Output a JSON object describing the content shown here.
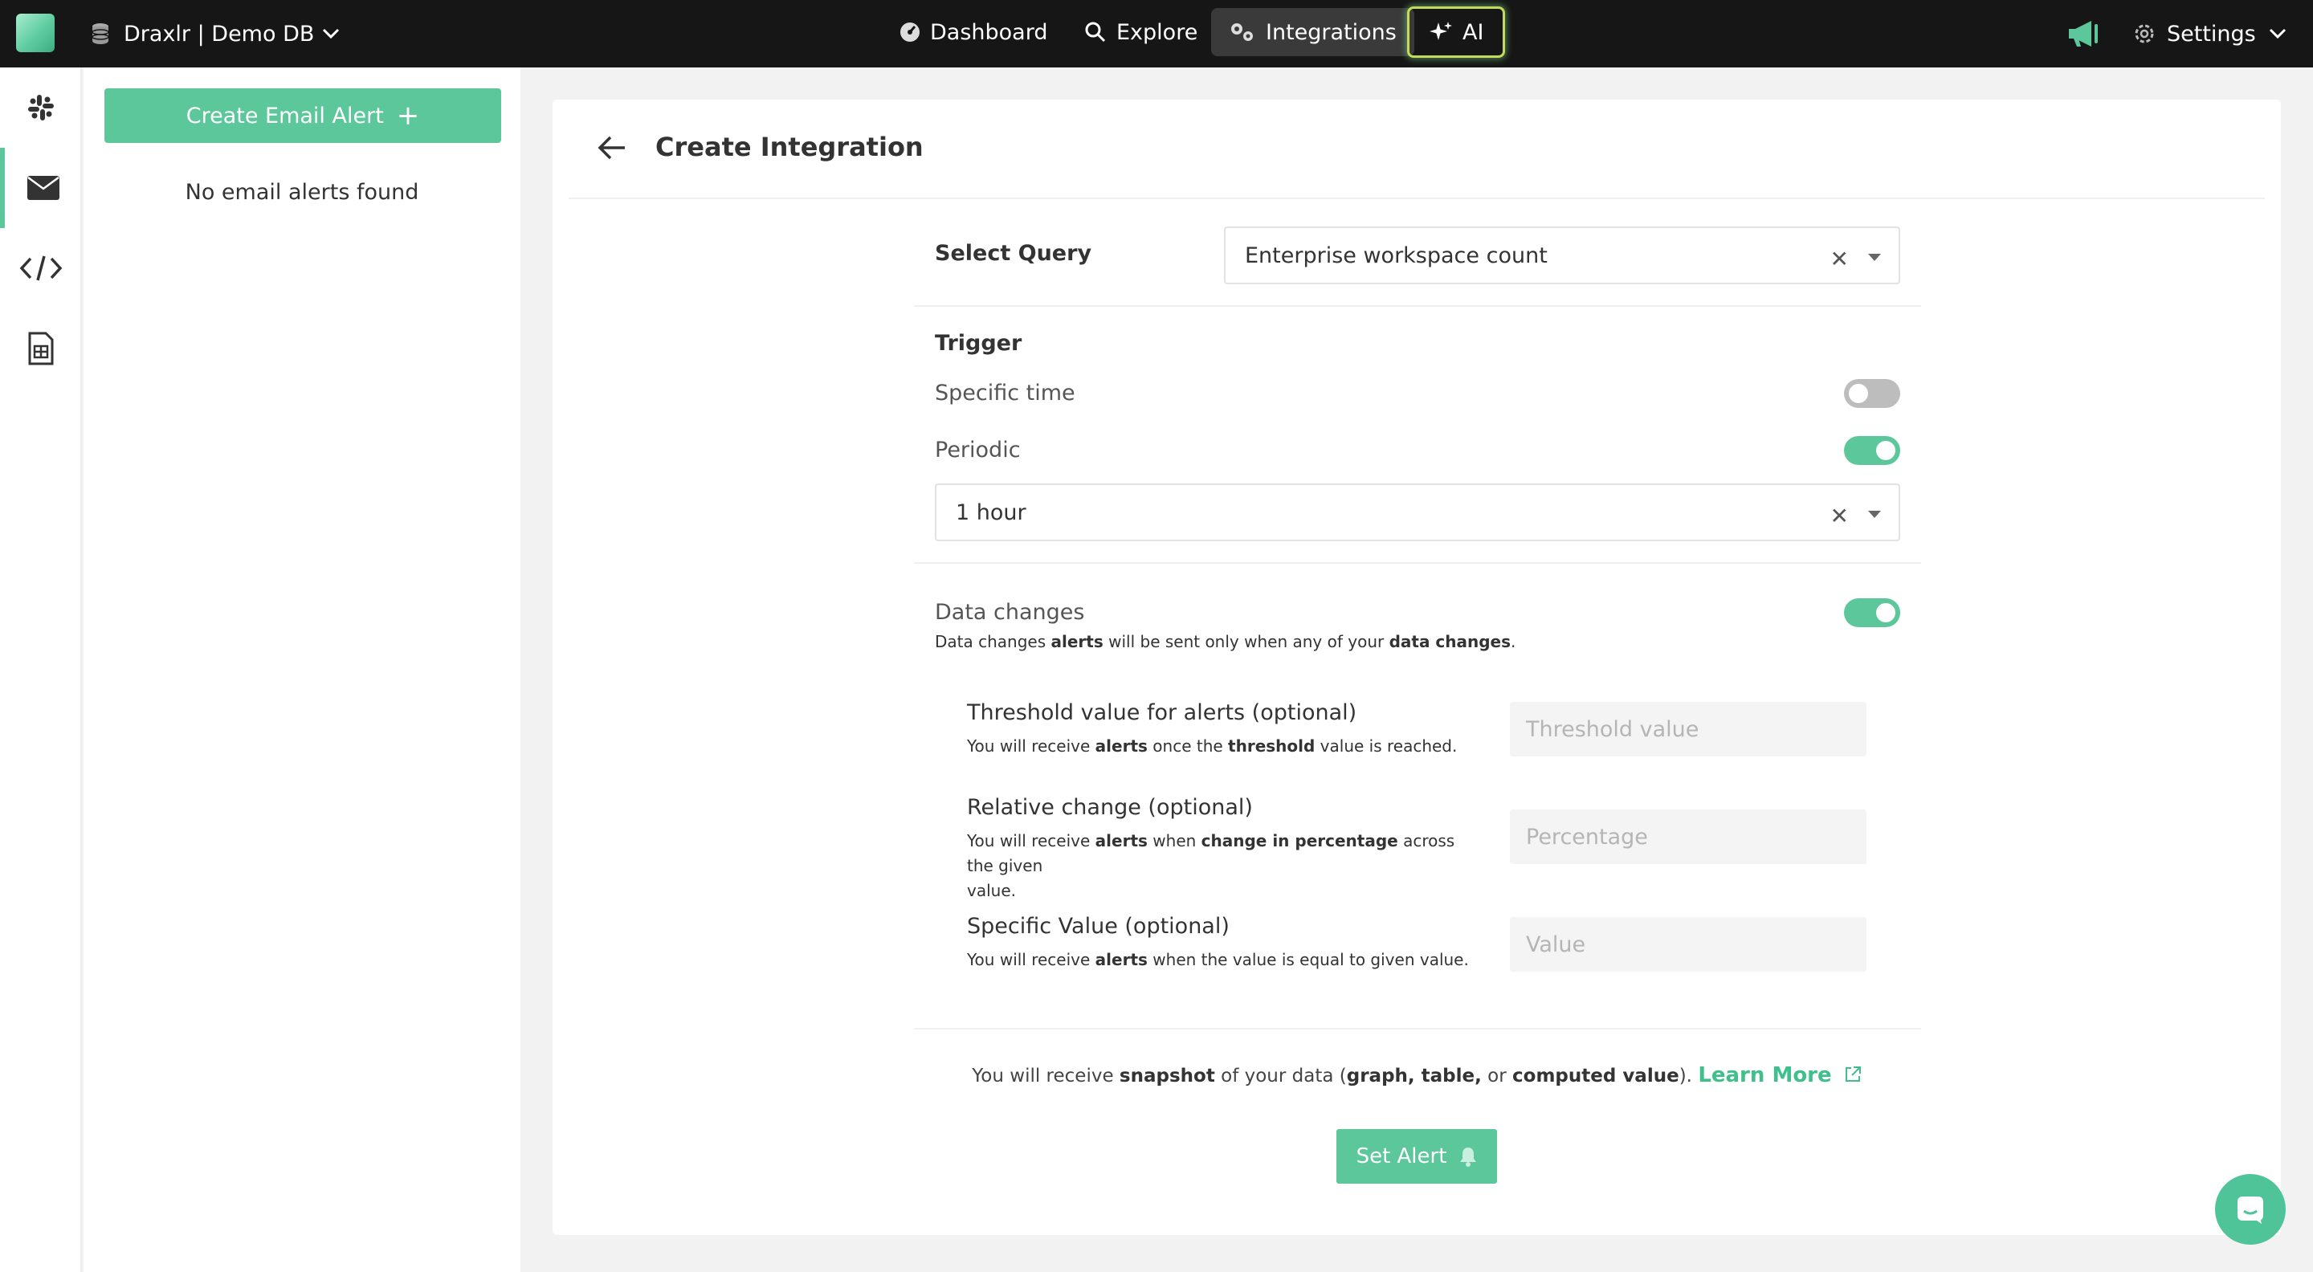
{
  "topbar": {
    "db_label": "Draxlr | Demo DB",
    "nav": {
      "dashboard": "Dashboard",
      "explore": "Explore",
      "integrations": "Integrations",
      "ai": "AI"
    },
    "settings": "Settings"
  },
  "sidebar": {
    "items": [
      "slack-icon",
      "email-icon",
      "code-icon",
      "sheet-icon"
    ],
    "active": "email-icon"
  },
  "alerts_panel": {
    "create_button": "Create Email Alert",
    "create_plus": "+",
    "empty_text": "No email alerts found"
  },
  "page": {
    "title": "Create Integration"
  },
  "form": {
    "select_query_label": "Select Query",
    "select_query_value": "Enterprise workspace count",
    "trigger_label": "Trigger",
    "specific_time_label": "Specific time",
    "specific_time_on": false,
    "periodic_label": "Periodic",
    "periodic_on": true,
    "periodic_value": "1 hour",
    "data_changes_label": "Data changes",
    "data_changes_on": true,
    "data_changes_help": {
      "t1": "Data changes ",
      "b1": "alerts",
      "t2": " will be sent only when any of your ",
      "b2": "data changes",
      "t3": "."
    },
    "threshold": {
      "label": "Threshold value for alerts (optional)",
      "help_t1": "You will receive ",
      "help_b1": "alerts",
      "help_t2": " once the ",
      "help_b2": "threshold",
      "help_t3": " value is reached.",
      "placeholder": "Threshold value"
    },
    "relative": {
      "label": "Relative change (optional)",
      "help_t1": "You will receive ",
      "help_b1": "alerts",
      "help_t2": " when ",
      "help_b2": "change in percentage",
      "help_t3": " across the given",
      "help_t4": "value.",
      "placeholder": "Percentage"
    },
    "specific_value": {
      "label": "Specific Value (optional)",
      "help_t1": "You will receive ",
      "help_b1": "alerts",
      "help_t2": " when the value is equal to given value.",
      "placeholder": "Value"
    }
  },
  "footer": {
    "t1": "You will receive ",
    "b1": "snapshot",
    "t2": " of your data (",
    "b2": "graph, table,",
    "t3": " or ",
    "b3": "computed value",
    "t4": "). ",
    "learn_more": "Learn More",
    "set_alert": "Set Alert"
  },
  "colors": {
    "accent": "#5cc79b",
    "topbar": "#161616",
    "ai_border": "#c5d95a"
  }
}
